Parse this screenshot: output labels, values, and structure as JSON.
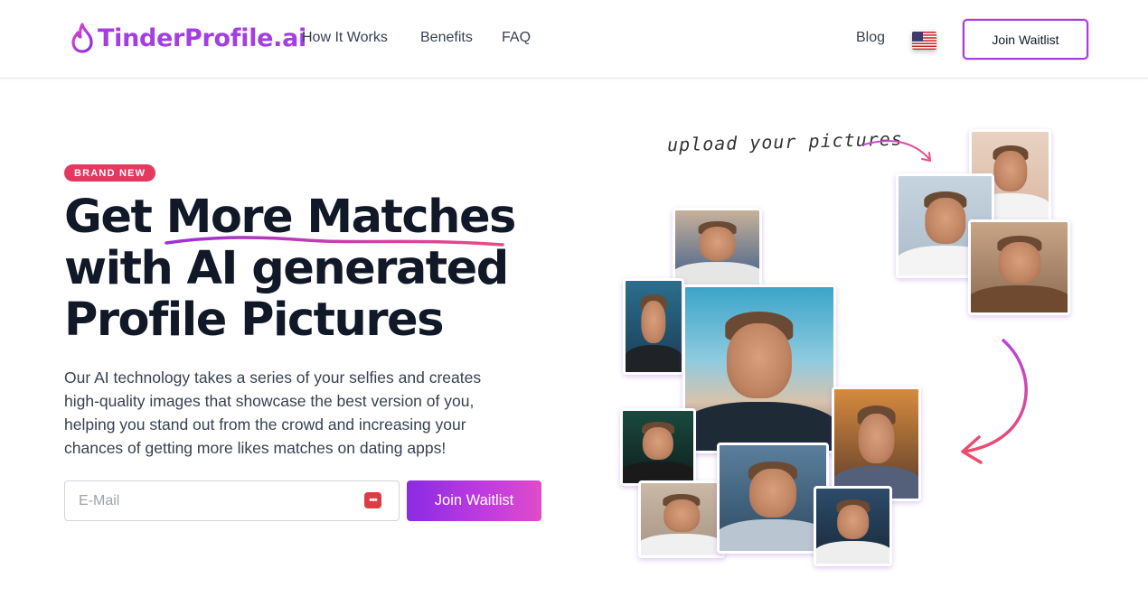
{
  "brand": {
    "name": "TinderProfile.ai",
    "color": "#a43ee0"
  },
  "nav": {
    "links": [
      "How It Works",
      "Benefits",
      "FAQ"
    ],
    "blog": "Blog",
    "language_icon": "us-flag-icon",
    "join_label": "Join Waitlist"
  },
  "hero": {
    "badge": "BRAND NEW",
    "headline": [
      "Get More Matches",
      "with AI generated",
      "Profile Pictures"
    ],
    "description": "Our AI technology takes a series of your selfies and creates high-quality images that showcase the best version of you, helping you stand out from the crowd and increasing your chances of getting more likes matches on dating apps!",
    "email_placeholder": "E-Mail",
    "cta_label": "Join Waitlist"
  },
  "illustration": {
    "upload_caption": "upload your pictures"
  },
  "colors": {
    "accent": "#8a2be2",
    "pink": "#e5385f",
    "text": "#111827"
  }
}
